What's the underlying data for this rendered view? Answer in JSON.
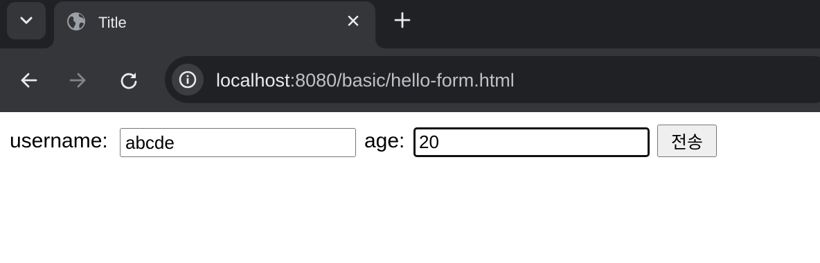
{
  "browser": {
    "tab": {
      "title": "Title",
      "favicon_icon": "globe-icon"
    },
    "tab_search_icon": "chevron-down-icon",
    "close_icon": "close-icon",
    "new_tab_icon": "plus-icon",
    "toolbar": {
      "back_icon": "arrow-left-icon",
      "forward_icon": "arrow-right-icon",
      "reload_icon": "reload-icon",
      "site_info_icon": "info-icon",
      "url_host": "localhost",
      "url_rest": ":8080/basic/hello-form.html"
    },
    "colors": {
      "tabstrip": "#202124",
      "active_tab": "#35363a",
      "omnibox": "#202124",
      "text": "#e8eaed"
    }
  },
  "form": {
    "username_label": "username:",
    "username_value": "abcde",
    "age_label": "age:",
    "age_value": "20",
    "submit_label": "전송"
  }
}
